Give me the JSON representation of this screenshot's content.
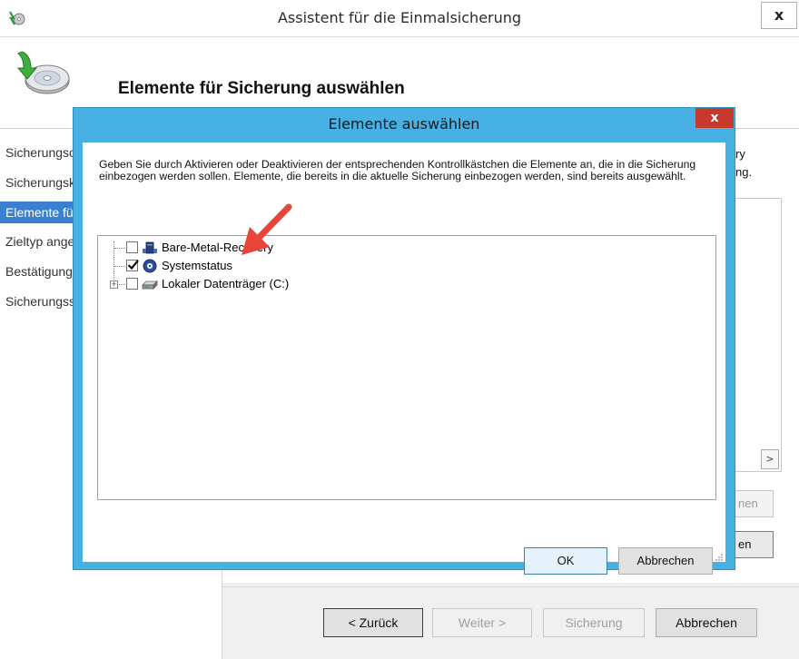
{
  "wizard": {
    "title": "Assistent für die Einmalsicherung",
    "close_label": "x",
    "heading": "Elemente für Sicherung auswählen",
    "steps": [
      {
        "label": "Sicherungsoptionen"
      },
      {
        "label": "Sicherungskonfiguration auswählen"
      },
      {
        "label": "Elemente für Sicherung auswählen"
      },
      {
        "label": "Zieltyp angeben"
      },
      {
        "label": "Bestätigung"
      },
      {
        "label": "Sicherungsstatus"
      }
    ],
    "right_text_line1": "ry",
    "right_text_line2": "ng.",
    "remove_label": "nen",
    "add_label": "en",
    "scroll_right": ">",
    "buttons": {
      "back": "< Zurück",
      "next": "Weiter >",
      "backup": "Sicherung",
      "cancel": "Abbrechen"
    }
  },
  "dialog": {
    "title": "Elemente auswählen",
    "close_label": "x",
    "description": "Geben Sie durch Aktivieren oder Deaktivieren der entsprechenden Kontrollkästchen die Elemente an, die in die Sicherung einbezogen werden sollen. Elemente, die bereits in die aktuelle Sicherung einbezogen werden, sind bereits ausgewählt.",
    "tree": [
      {
        "label": "Bare-Metal-Recovery",
        "checked": false,
        "icon": "bare-metal-icon"
      },
      {
        "label": "Systemstatus",
        "checked": true,
        "icon": "system-state-icon"
      },
      {
        "label": "Lokaler Datenträger (C:)",
        "checked": false,
        "icon": "drive-icon"
      }
    ],
    "ok_label": "OK",
    "cancel_label": "Abbrechen"
  },
  "colors": {
    "dialog_frame": "#48b1e4",
    "close_red": "#c7392c",
    "step_active": "#3a7fd0",
    "annotation_arrow": "#e8453a"
  }
}
